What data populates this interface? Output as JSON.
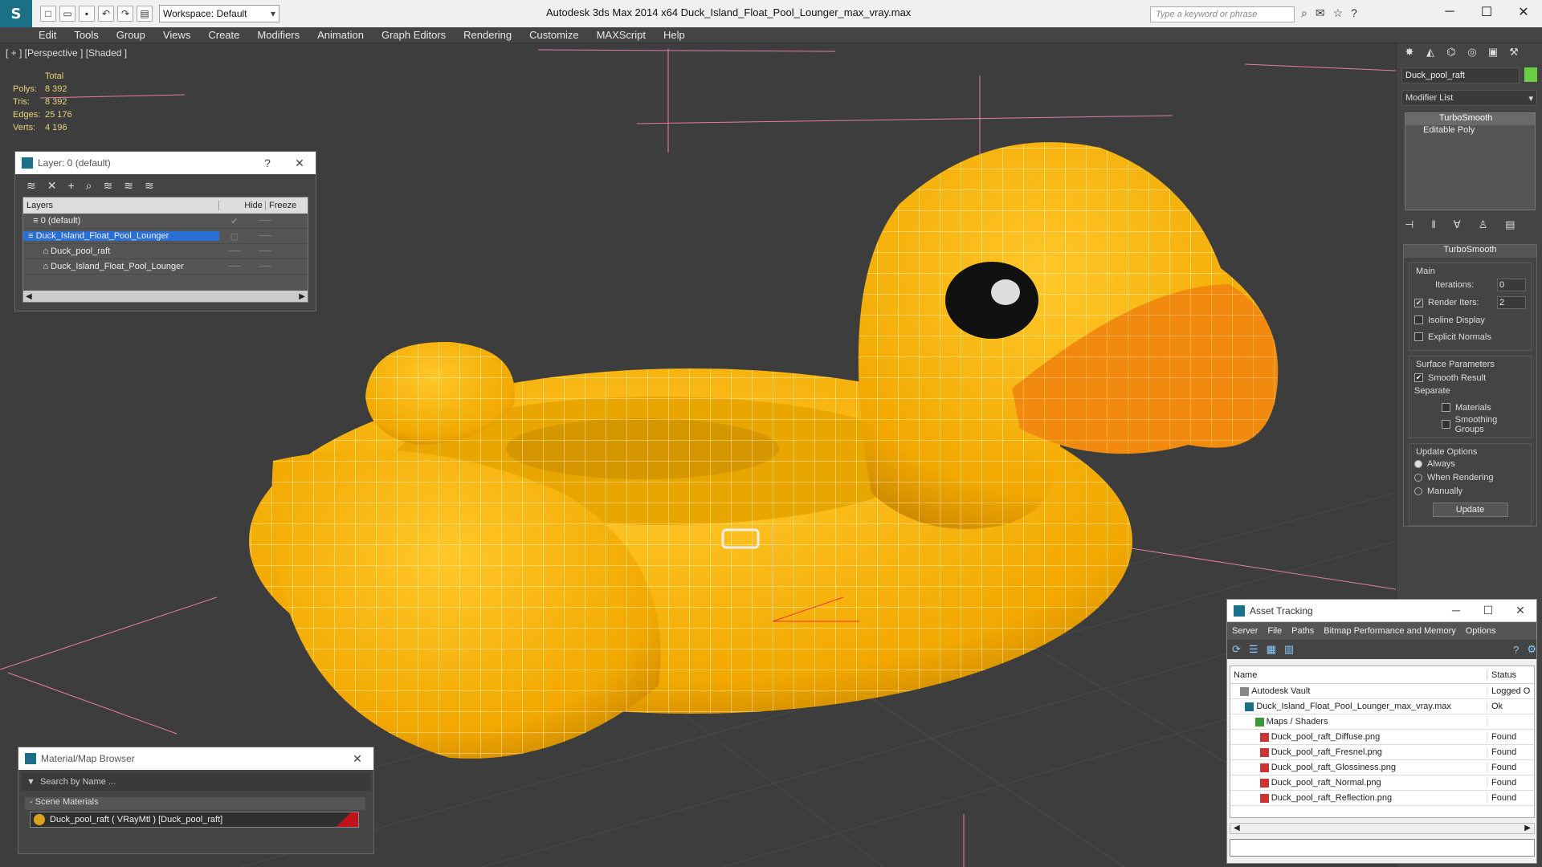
{
  "app": {
    "logo_glyph": "S",
    "title": "Autodesk 3ds Max  2014 x64       Duck_Island_Float_Pool_Lounger_max_vray.max",
    "workspace": "Workspace: Default",
    "search_placeholder": "Type a keyword or phrase",
    "win_min": "─",
    "win_max": "☐",
    "win_close": "✕"
  },
  "menu": [
    "Edit",
    "Tools",
    "Group",
    "Views",
    "Create",
    "Modifiers",
    "Animation",
    "Graph Editors",
    "Rendering",
    "Customize",
    "MAXScript",
    "Help"
  ],
  "viewport": {
    "label": "[ + ] [Perspective ] [Shaded ]",
    "stats_title": "Total",
    "stats": [
      {
        "k": "Polys:",
        "v": "8 392"
      },
      {
        "k": "Tris:",
        "v": "8 392"
      },
      {
        "k": "Edges:",
        "v": "25 176"
      },
      {
        "k": "Verts:",
        "v": "4 196"
      }
    ]
  },
  "layer_panel": {
    "title": "Layer: 0 (default)",
    "help": "?",
    "close": "✕",
    "col_layers": "Layers",
    "col_hide": "Hide",
    "col_freeze": "Freeze",
    "rows": [
      {
        "name": "0 (default)",
        "indent": "    ",
        "hide": "✔"
      },
      {
        "name": "Duck_Island_Float_Pool_Lounger",
        "indent": "  ",
        "hide": "▢"
      },
      {
        "name": "Duck_pool_raft",
        "indent": "        ",
        "hide": "──"
      },
      {
        "name": "Duck_Island_Float_Pool_Lounger",
        "indent": "        ",
        "hide": "──"
      }
    ]
  },
  "material_browser": {
    "title": "Material/Map Browser",
    "close": "✕",
    "search_placeholder": "Search by Name ...",
    "section": "- Scene Materials",
    "item": "Duck_pool_raft  ( VRayMtl ) [Duck_pool_raft]"
  },
  "command_panel": {
    "object_name": "Duck_pool_raft",
    "object_color": "#6ccc44",
    "modifier_list": "Modifier List",
    "stack": [
      "TurboSmooth",
      "Editable Poly"
    ],
    "rollout": "TurboSmooth",
    "main_group": "Main",
    "iterations_label": "Iterations:",
    "iterations": "0",
    "render_iters_label": "Render Iters:",
    "render_iters": "2",
    "isoline": "Isoline Display",
    "explicit": "Explicit Normals",
    "surface_group": "Surface Parameters",
    "smooth_result": "Smooth Result",
    "separate": "Separate",
    "materials": "Materials",
    "smoothing_groups": "Smoothing Groups",
    "update_group": "Update Options",
    "always": "Always",
    "when_rendering": "When Rendering",
    "manually": "Manually",
    "update_btn": "Update"
  },
  "asset_tracking": {
    "title": "Asset Tracking",
    "menu": [
      "Server",
      "File",
      "Paths",
      "Bitmap Performance and Memory",
      "Options"
    ],
    "col_name": "Name",
    "col_status": "Status",
    "rows": [
      {
        "name": "Autodesk Vault",
        "status": "Logged O",
        "indent": "    ",
        "icon": "vault"
      },
      {
        "name": "Duck_Island_Float_Pool_Lounger_max_vray.max",
        "status": "Ok",
        "indent": "      ",
        "icon": "file"
      },
      {
        "name": "Maps / Shaders",
        "status": "",
        "indent": "          ",
        "icon": "maps"
      },
      {
        "name": "Duck_pool_raft_Diffuse.png",
        "status": "Found",
        "indent": "            ",
        "icon": "png"
      },
      {
        "name": "Duck_pool_raft_Fresnel.png",
        "status": "Found",
        "indent": "            ",
        "icon": "png"
      },
      {
        "name": "Duck_pool_raft_Glossiness.png",
        "status": "Found",
        "indent": "            ",
        "icon": "png"
      },
      {
        "name": "Duck_pool_raft_Normal.png",
        "status": "Found",
        "indent": "            ",
        "icon": "png"
      },
      {
        "name": "Duck_pool_raft_Reflection.png",
        "status": "Found",
        "indent": "            ",
        "icon": "png"
      }
    ]
  }
}
